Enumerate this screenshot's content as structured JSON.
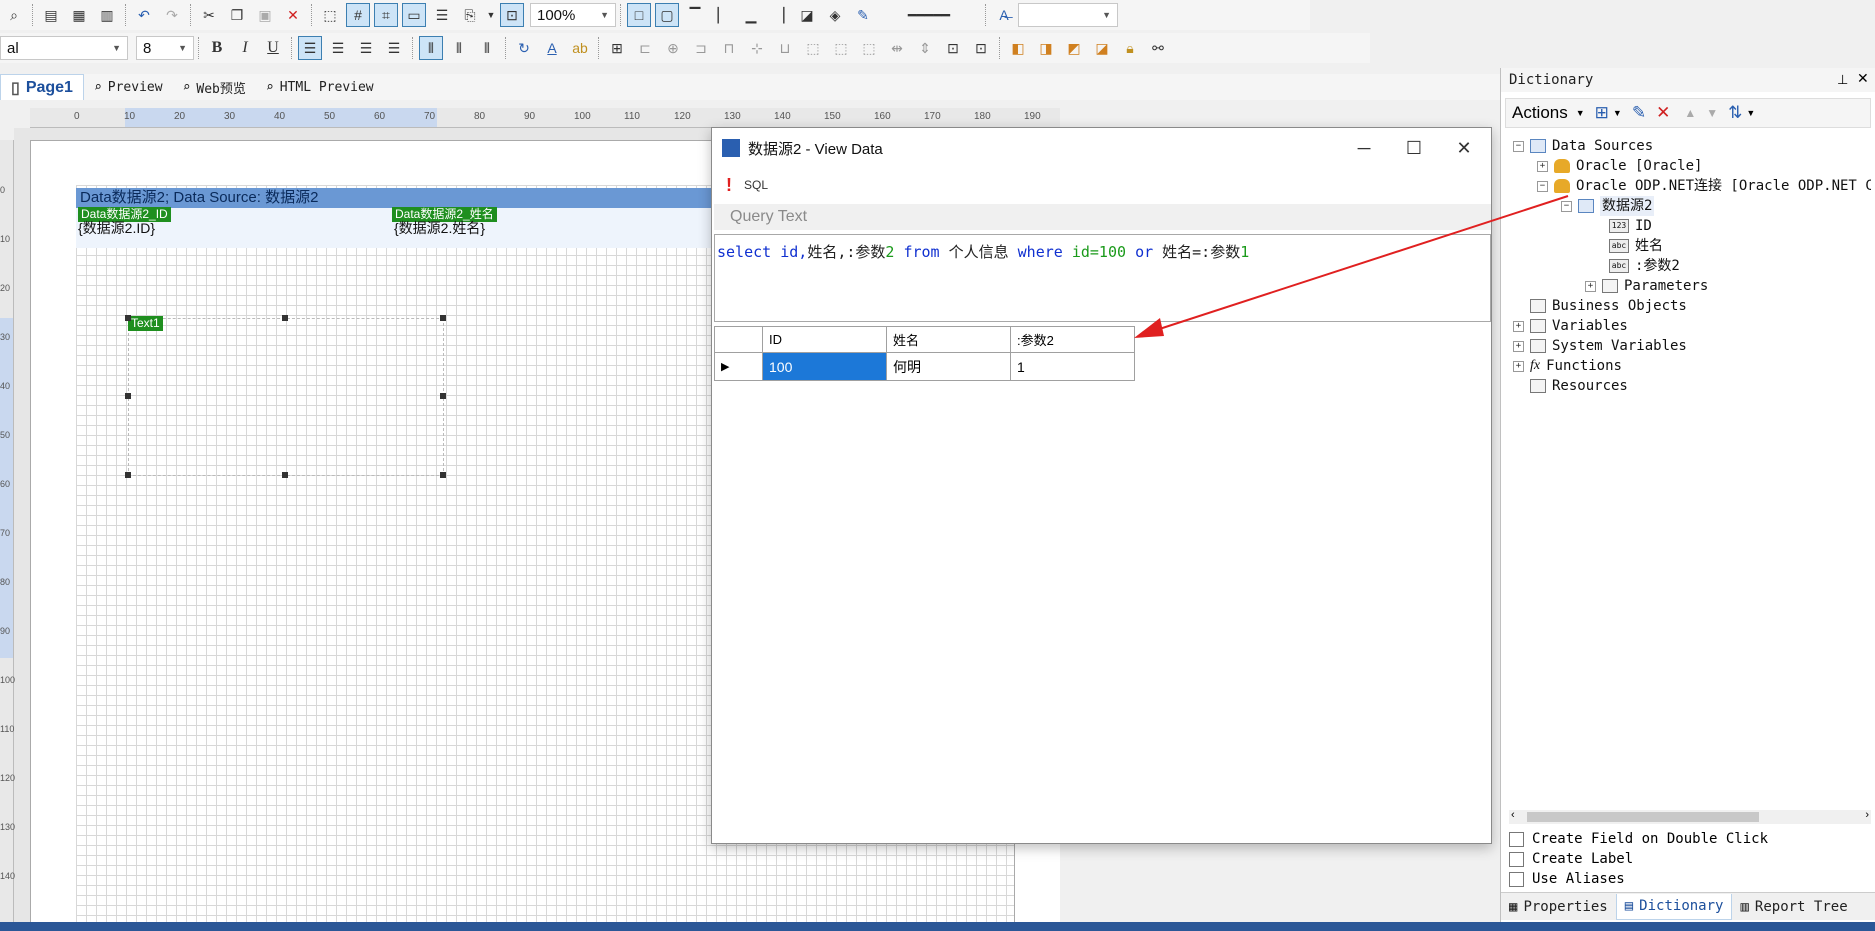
{
  "toolbar1": {
    "zoom": "100%"
  },
  "toolbar2": {
    "font_name": "al",
    "font_size": "8"
  },
  "toolbar_icons": [
    "bold-icon",
    "italic-icon",
    "underline-icon",
    "align-left-icon",
    "align-center-icon",
    "align-right-icon",
    "justify-icon"
  ],
  "toolbar_labels": {
    "bold": "B",
    "italic": "I",
    "underline": "U",
    "text_color": "A"
  },
  "doc_tabs": [
    "Page1",
    "Preview",
    "Web预览",
    "HTML Preview"
  ],
  "ruler_ticks": [
    "0",
    "10",
    "20",
    "30",
    "40",
    "50",
    "60",
    "70",
    "80",
    "90",
    "100",
    "110",
    "120",
    "130",
    "140",
    "150",
    "160",
    "170",
    "180",
    "190"
  ],
  "ruler_vertical_ticks": [
    "0",
    "10",
    "20",
    "30",
    "40",
    "50",
    "60",
    "70",
    "80",
    "90",
    "100",
    "110",
    "120",
    "130",
    "140"
  ],
  "design": {
    "band_title": "Data数据源2; Data Source: 数据源2",
    "tag1": "Data数据源2_ID",
    "tag2": "Data数据源2_姓名",
    "field1": "{数据源2.ID}",
    "field2": "{数据源2.姓名}",
    "text_component": "Text1"
  },
  "dialog": {
    "title": "数据源2 - View Data",
    "sql_label": "SQL",
    "exclamation": "!",
    "query_label": "Query Text",
    "query_parts": {
      "select": "select",
      "ident": "id,",
      "name_field": "姓名",
      "comma_param": ",:参数",
      "digit2": "2",
      "from": "from",
      "table": "个人信息",
      "where": "where",
      "cond": "id=100",
      "or": "or",
      "name_eq": "姓名=:参数",
      "digit1": "1"
    },
    "columns": [
      "ID",
      "姓名",
      ":参数2"
    ],
    "rows": [
      {
        "id": "100",
        "name": "何明",
        "param": "1"
      }
    ],
    "row_indicator": "▶"
  },
  "dictionary": {
    "title": "Dictionary",
    "actions_label": "Actions",
    "tree": {
      "data_sources": "Data Sources",
      "oracle": "Oracle [Oracle]",
      "oracle_odp": "Oracle ODP.NET连接 [Oracle ODP.NET Conn",
      "datasource2": "数据源2",
      "field_id": "ID",
      "field_name": "姓名",
      "field_param": ":参数2",
      "parameters": "Parameters",
      "business_objects": "Business Objects",
      "variables": "Variables",
      "system_variables": "System Variables",
      "functions": "Functions",
      "resources": "Resources"
    },
    "options": {
      "create_field": "Create Field on Double Click",
      "create_label": "Create Label",
      "use_aliases": "Use Aliases"
    },
    "bottom_tabs": [
      "Properties",
      "Dictionary",
      "Report Tree"
    ]
  },
  "colors": {
    "accent": "#1c78d8",
    "band": "#6a98d4",
    "tag": "#1f8f1f",
    "arrow": "#e02020"
  }
}
